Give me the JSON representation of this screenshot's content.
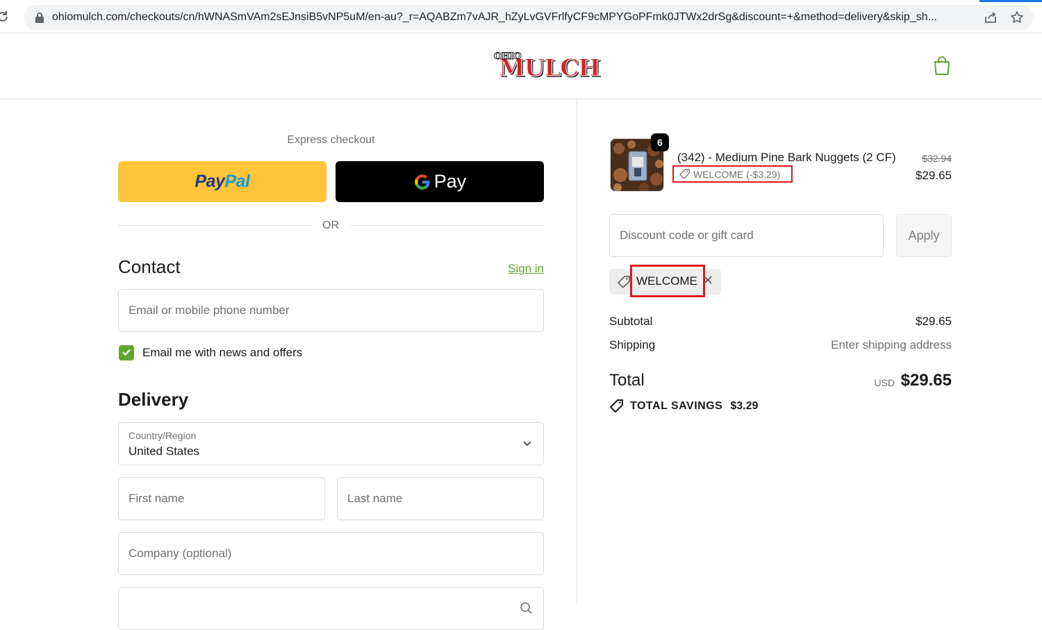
{
  "browser": {
    "url": "ohiomulch.com/checkouts/cn/hWNASmVAm2sEJnsiB5vNP5uM/en-au?_r=AQABZm7vAJR_hZyLvGVFrlfyCF9cMPYGoPFmk0JTWx2drSg&discount=+&method=delivery&skip_sh..."
  },
  "header": {
    "logo_top": "OHIO",
    "logo_main": "MULCH"
  },
  "express": {
    "label": "Express checkout",
    "paypal_pay": "Pay",
    "paypal_pal": "Pal",
    "gpay_label": "Pay",
    "or_label": "OR"
  },
  "contact": {
    "heading": "Contact",
    "signin": "Sign in",
    "email_placeholder": "Email or mobile phone number",
    "newsletter_label": "Email me with news and offers",
    "newsletter_checked": true
  },
  "delivery": {
    "heading": "Delivery",
    "country_label": "Country/Region",
    "country_value": "United States",
    "first_name_placeholder": "First name",
    "last_name_placeholder": "Last name",
    "company_placeholder": "Company (optional)"
  },
  "order": {
    "item": {
      "quantity": "6",
      "name": "(342) - Medium Pine Bark Nuggets (2 CF)",
      "discount_tag": "WELCOME (-$3.29)",
      "compare_price": "$32.94",
      "price": "$29.65"
    },
    "discount_placeholder": "Discount code or gift card",
    "apply_label": "Apply",
    "applied_code": "WELCOME",
    "subtotal_label": "Subtotal",
    "subtotal_value": "$29.65",
    "shipping_label": "Shipping",
    "shipping_value": "Enter shipping address",
    "total_label": "Total",
    "total_currency": "USD",
    "total_value": "$29.65",
    "savings_label": "TOTAL SAVINGS",
    "savings_value": "$3.29"
  },
  "colors": {
    "accent_green": "#5fa732",
    "highlight_red": "#e0191f",
    "paypal_yellow": "#ffc439"
  }
}
